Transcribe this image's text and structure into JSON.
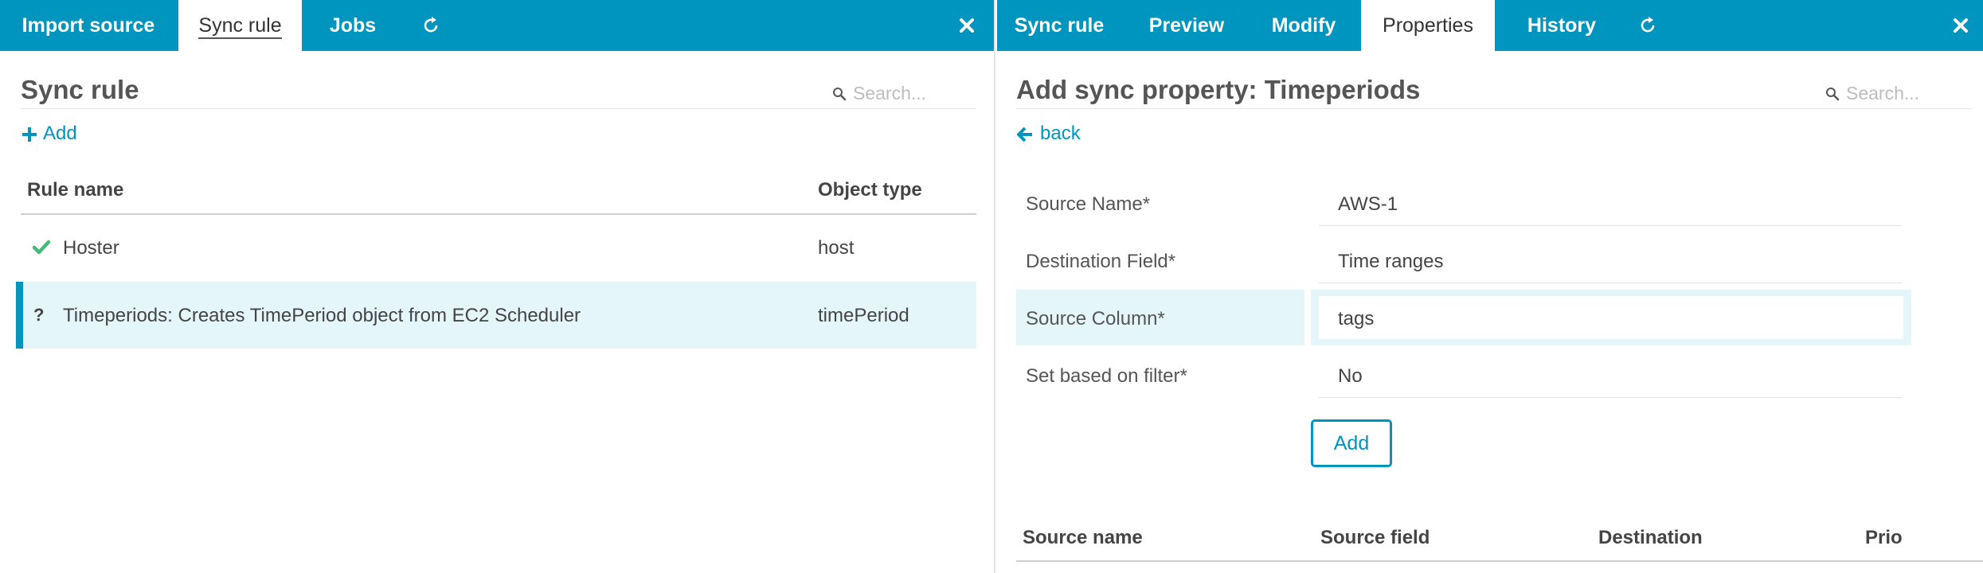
{
  "left": {
    "tabs": [
      "Import source",
      "Sync rule",
      "Jobs"
    ],
    "active_tab": "Sync rule",
    "title": "Sync rule",
    "search_placeholder": "Search...",
    "add_label": "Add",
    "columns": [
      "Rule name",
      "Object type"
    ],
    "rows": [
      {
        "status": "check-icon",
        "name": "Hoster",
        "type": "host",
        "selected": false
      },
      {
        "status": "question-icon",
        "name": "Timeperiods: Creates TimePeriod object from EC2 Scheduler",
        "type": "timePeriod",
        "selected": true
      }
    ]
  },
  "right": {
    "tabs": [
      "Sync rule",
      "Preview",
      "Modify",
      "Properties",
      "History"
    ],
    "active_tab": "Properties",
    "title": "Add sync property: Timeperiods",
    "search_placeholder": "Search...",
    "back_label": "back",
    "form": [
      {
        "label": "Source Name*",
        "value": "AWS-1"
      },
      {
        "label": "Destination Field*",
        "value": "Time ranges"
      },
      {
        "label": "Source Column*",
        "value": "tags"
      },
      {
        "label": "Set based on filter*",
        "value": "No"
      }
    ],
    "submit_label": "Add",
    "columns": [
      "Source name",
      "Source field",
      "Destination",
      "Prio"
    ]
  },
  "colors": {
    "accent": "#0095bf",
    "selected_row": "#e5f6fb",
    "ok": "#44bb77"
  }
}
